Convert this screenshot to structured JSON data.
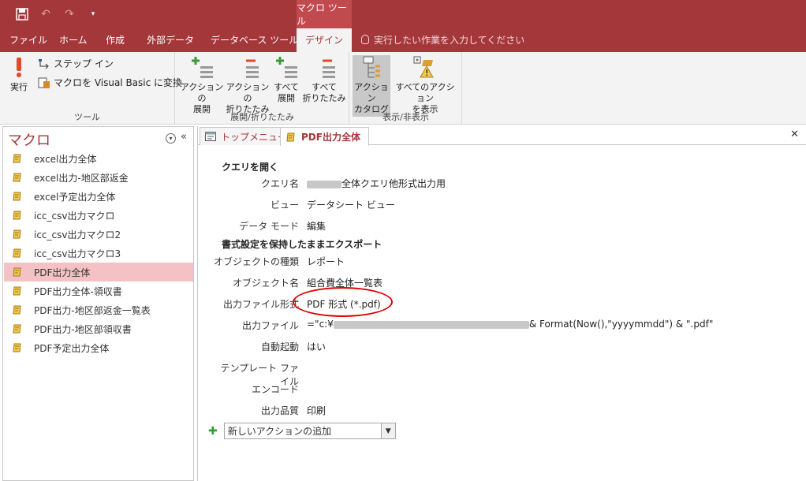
{
  "titlebar": {
    "context_tool": "マクロ ツール",
    "color": "#a4373a"
  },
  "ribbon_tabs": {
    "file": "ファイル",
    "home": "ホーム",
    "create": "作成",
    "external": "外部データ",
    "database_tools": "データベース ツール",
    "design": "デザイン",
    "tell_me": "実行したい作業を入力してください"
  },
  "ribbon": {
    "tools": {
      "run": "実行",
      "step_in": "ステップ イン",
      "convert_vb": "マクロを Visual Basic に変換",
      "group_label": "ツール"
    },
    "expand_collapse": {
      "expand_action_1": "アクションの",
      "expand_action_2": "展開",
      "collapse_action_1": "アクションの",
      "collapse_action_2": "折りたたみ",
      "expand_all_1": "すべて",
      "expand_all_2": "展開",
      "collapse_all_1": "すべて",
      "collapse_all_2": "折りたたみ",
      "group_label": "展開/折りたたみ"
    },
    "show_hide": {
      "catalog_1": "アクション",
      "catalog_2": "カタログ",
      "show_all_1": "すべてのアクション",
      "show_all_2": "を表示",
      "group_label": "表示/非表示"
    }
  },
  "nav": {
    "title": "マクロ",
    "items": [
      "excel出力全体",
      "excel出力-地区部返金",
      "excel予定出力全体",
      "icc_csv出力マクロ",
      "icc_csv出力マクロ2",
      "icc_csv出力マクロ3",
      "PDF出力全体",
      "PDF出力全体-領収書",
      "PDF出力-地区部返金一覧表",
      "PDF出力-地区部領収書",
      "PDF予定出力全体"
    ]
  },
  "doc_tabs": {
    "tab1": "トップメニュー",
    "tab2": "PDF出力全体",
    "close": "✕"
  },
  "macro": {
    "action1_title": "クエリを開く",
    "action1_args": {
      "query_label": "クエリ名",
      "query_value": "全体クエリ他形式出力用",
      "view_label": "ビュー",
      "view_value": "データシート ビュー",
      "mode_label": "データ モード",
      "mode_value": "編集"
    },
    "action2_title": "書式設定を保持したままエクスポート",
    "action2_args": {
      "objtype_label": "オブジェクトの種類",
      "objtype_value": "レポート",
      "objname_label": "オブジェクト名",
      "objname_value": "組合費全体一覧表",
      "format_label": "出力ファイル形式",
      "format_value": "PDF 形式 (*.pdf)",
      "outfile_label": "出力ファイル",
      "outfile_prefix": "=\"c:¥",
      "outfile_suffix": "& Format(Now(),\"yyyymmdd\") & \".pdf\"",
      "autostart_label": "自動起動",
      "autostart_value": "はい",
      "template_label": "テンプレート ファイル",
      "template_value": "",
      "encode_label": "エンコード",
      "encode_value": "",
      "quality_label": "出力品質",
      "quality_value": "印刷"
    },
    "add_action": "新しいアクションの追加"
  }
}
